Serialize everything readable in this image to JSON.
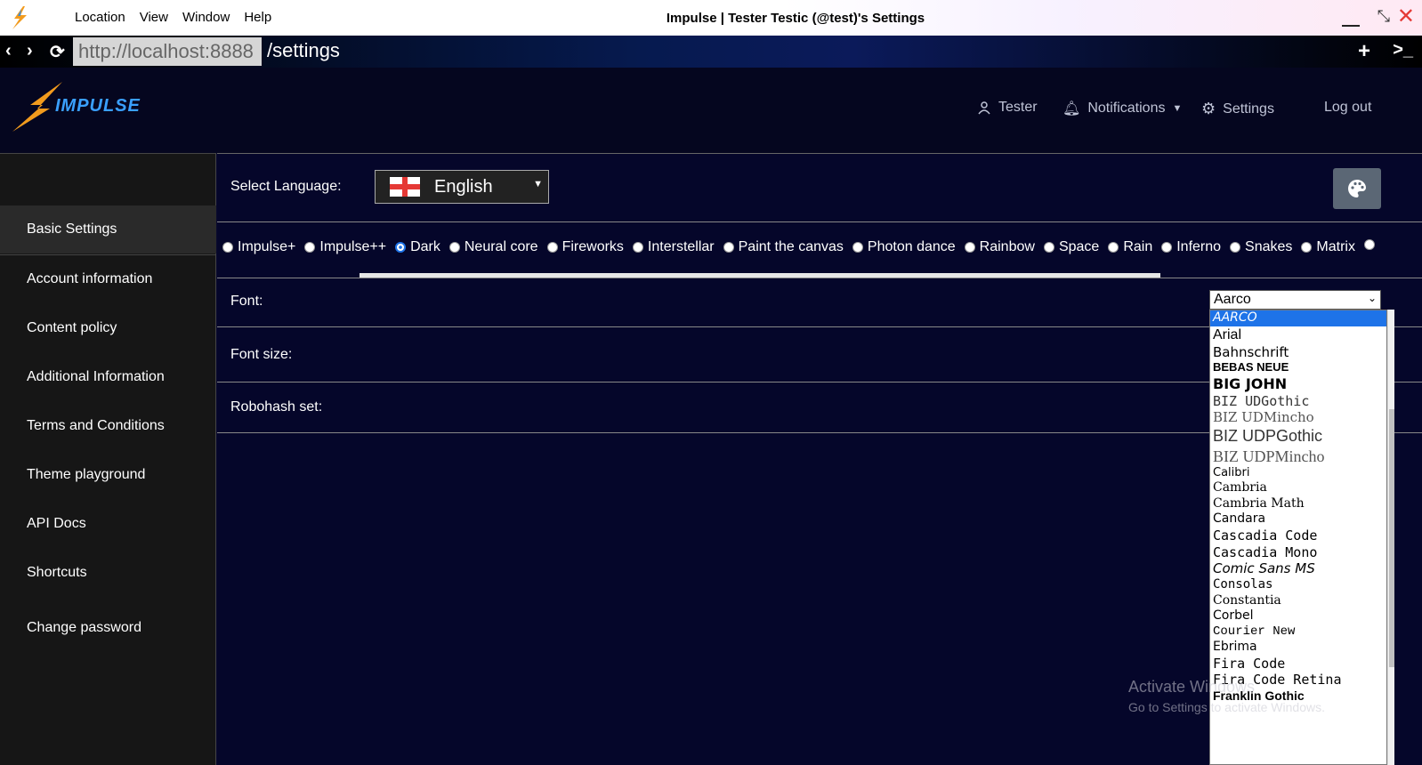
{
  "titlebar": {
    "menu": [
      "Location",
      "View",
      "Window",
      "Help"
    ],
    "title": "Impulse | Tester Testic (@test)'s Settings"
  },
  "addressbar": {
    "origin": "http://localhost:8888",
    "path": "/settings"
  },
  "header": {
    "brand": "IMPULSE",
    "user": "Tester",
    "notifications": "Notifications",
    "settings": "Settings",
    "logout": "Log out"
  },
  "sidebar": {
    "items": [
      "Basic Settings",
      "Account information",
      "Content policy",
      "Additional Information",
      "Terms and Conditions",
      "Theme playground",
      "API Docs",
      "Shortcuts",
      "Change password"
    ]
  },
  "language": {
    "label": "Select Language:",
    "value": "English"
  },
  "themes": [
    {
      "label": "Impulse+",
      "selected": false
    },
    {
      "label": "Impulse++",
      "selected": false
    },
    {
      "label": "Dark",
      "selected": true
    },
    {
      "label": "Neural core",
      "selected": false
    },
    {
      "label": "Fireworks",
      "selected": false
    },
    {
      "label": "Interstellar",
      "selected": false
    },
    {
      "label": "Paint the canvas",
      "selected": false
    },
    {
      "label": "Photon dance",
      "selected": false
    },
    {
      "label": "Rainbow",
      "selected": false
    },
    {
      "label": "Space",
      "selected": false
    },
    {
      "label": "Rain",
      "selected": false
    },
    {
      "label": "Inferno",
      "selected": false
    },
    {
      "label": "Snakes",
      "selected": false
    },
    {
      "label": "Matrix",
      "selected": false
    }
  ],
  "settings_rows": {
    "font": "Font:",
    "font_size": "Font size:",
    "robohash": "Robohash set:"
  },
  "font_select": {
    "value": "Aarco",
    "options": [
      "AARCO",
      "Arial",
      "Bahnschrift",
      "BEBAS NEUE",
      "BIG JOHN",
      "BIZ UDGothic",
      "BIZ UDMincho",
      "BIZ UDPGothic",
      "BIZ UDPMincho",
      "Calibri",
      "Cambria",
      "Cambria Math",
      "Candara",
      "Cascadia Code",
      "Cascadia Mono",
      "Comic Sans MS",
      "Consolas",
      "Constantia",
      "Corbel",
      "Courier New",
      "Ebrima",
      "Fira Code",
      "Fira Code Retina",
      "Franklin Gothic"
    ]
  },
  "watermark": {
    "line1": "Activate Windows",
    "line2": "Go to Settings to activate Windows."
  }
}
